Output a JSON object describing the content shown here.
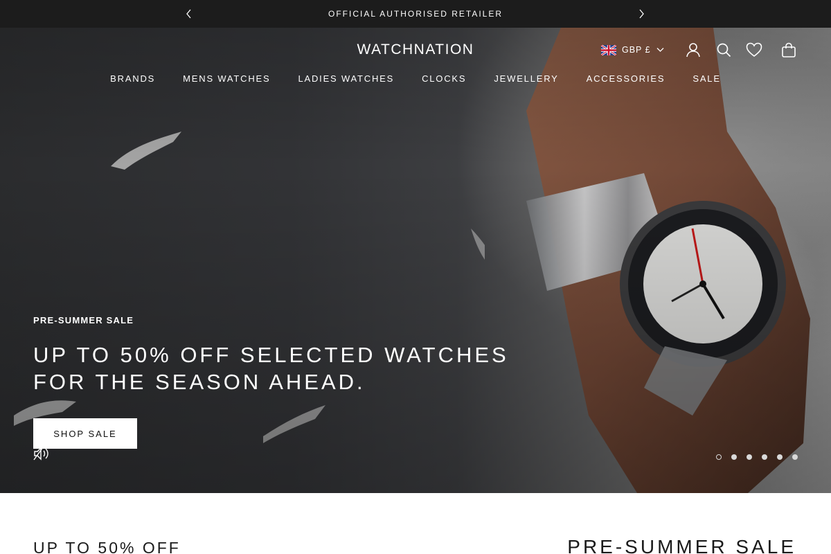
{
  "announcement": {
    "text": "OFFICIAL AUTHORISED RETAILER",
    "prev_icon": "chevron-left-icon",
    "next_icon": "chevron-right-icon"
  },
  "header": {
    "logo": "WATCHNATION",
    "currency": "GBP £",
    "currency_flag": "uk-flag",
    "icons": [
      "account-icon",
      "search-icon",
      "wishlist-heart-icon",
      "shopping-bag-icon"
    ]
  },
  "nav": {
    "items": [
      {
        "label": "BRANDS"
      },
      {
        "label": "MENS WATCHES"
      },
      {
        "label": "LADIES WATCHES"
      },
      {
        "label": "CLOCKS"
      },
      {
        "label": "JEWELLERY"
      },
      {
        "label": "ACCESSORIES"
      },
      {
        "label": "SALE"
      }
    ]
  },
  "hero": {
    "eyebrow": "PRE-SUMMER SALE",
    "headline_line1": "UP TO 50% OFF SELECTED WATCHES",
    "headline_line2": "FOR THE SEASON AHEAD.",
    "cta_label": "SHOP SALE",
    "sound_icon": "speaker-muted-icon",
    "slide_count": 6,
    "active_slide": 1
  },
  "below": {
    "left_heading": "UP TO 50% OFF",
    "right_heading": "PRE-SUMMER SALE"
  },
  "colors": {
    "announce_bg": "#1c1c1c",
    "text_light": "#ffffff",
    "cta_bg": "#ffffff"
  }
}
